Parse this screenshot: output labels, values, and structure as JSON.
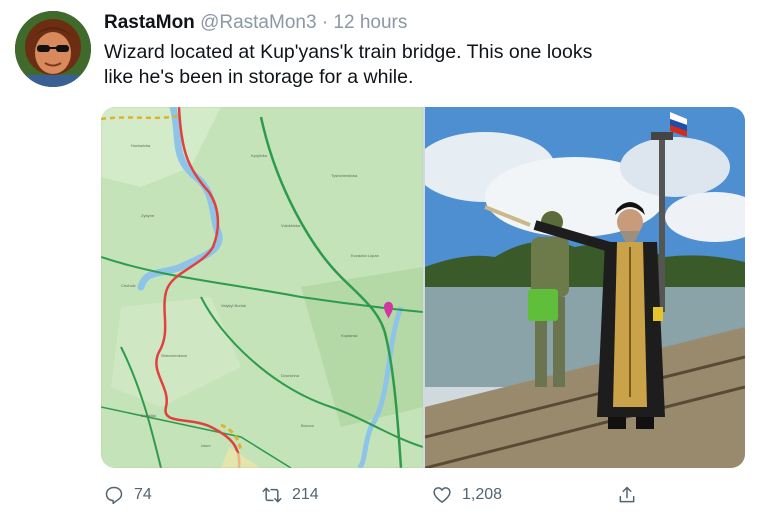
{
  "tweet": {
    "display_name": "RastaMon",
    "handle": "@RastaMon3",
    "separator": "·",
    "time": "12 hours",
    "text_line1": "Wizard located at Kup'yans'k train bridge. This one looks",
    "text_line2": "like he's been in storage for a while."
  },
  "actions": {
    "reply_count": "74",
    "retweet_count": "214",
    "like_count": "1,208"
  },
  "icons": {
    "reply": "reply-icon",
    "retweet": "retweet-icon",
    "like": "heart-icon",
    "share": "share-icon"
  },
  "colors": {
    "text": "#0f1419",
    "muted": "#536471",
    "map_land": "#bfe0b4",
    "river": "#8ec4e8"
  }
}
